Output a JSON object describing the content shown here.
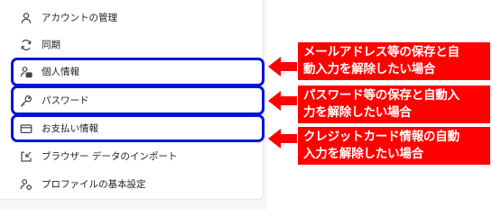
{
  "menu": {
    "items": [
      {
        "label": "アカウントの管理",
        "icon": "person-icon"
      },
      {
        "label": "同期",
        "icon": "sync-icon"
      },
      {
        "label": "個人情報",
        "icon": "personal-info-icon"
      },
      {
        "label": "パスワード",
        "icon": "key-icon"
      },
      {
        "label": "お支払い情報",
        "icon": "credit-card-icon"
      },
      {
        "label": "ブラウザー データのインポート",
        "icon": "import-icon"
      },
      {
        "label": "プロファイルの基本設定",
        "icon": "profile-settings-icon"
      }
    ]
  },
  "annotations": {
    "highlight_color": "#0015d8",
    "callout_color": "#ff0000",
    "callouts": [
      {
        "text": "メールアドレス等の保存と自\n動入力を解除したい場合"
      },
      {
        "text": "パスワード等の保存と自動入\n力を解除したい場合"
      },
      {
        "text": "クレジットカード情報の自動\n入力を解除したい場合"
      }
    ]
  }
}
